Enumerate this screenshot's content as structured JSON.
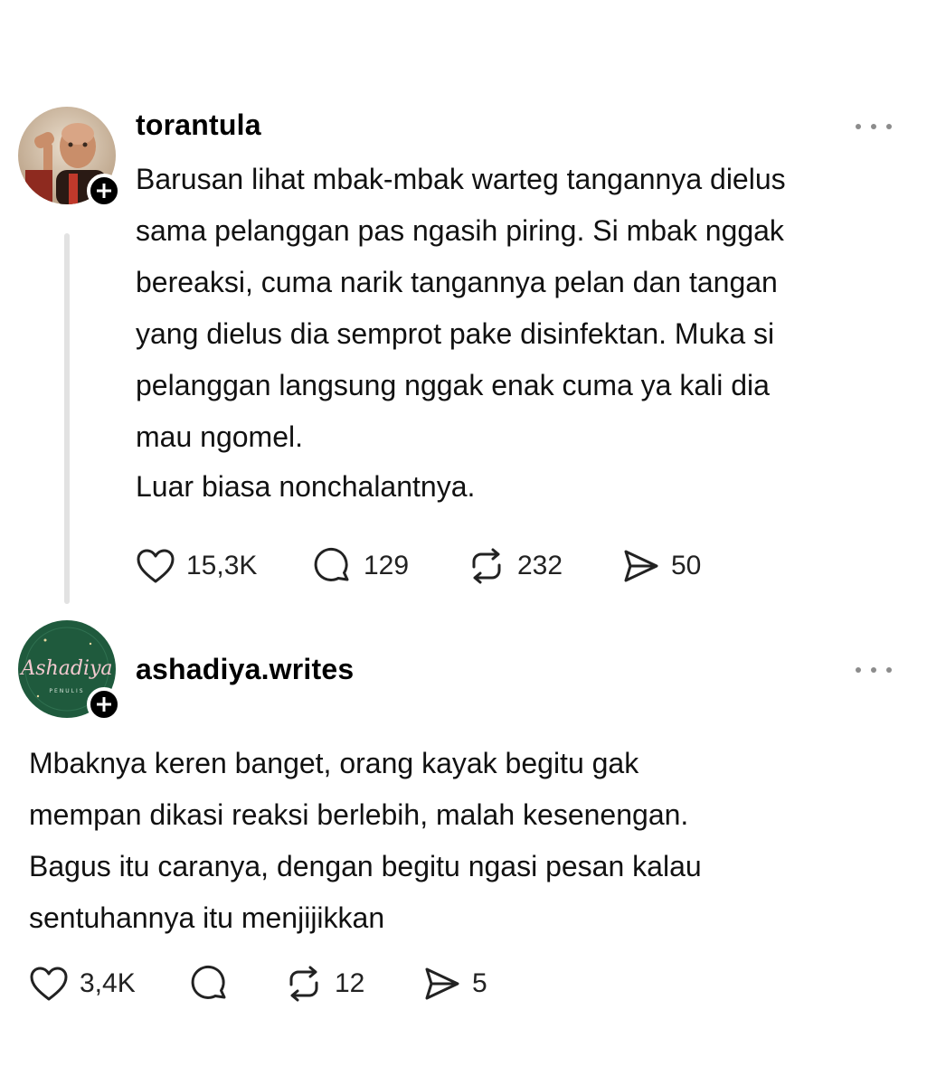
{
  "colors": {
    "background": "#ffffff",
    "text": "#111111",
    "muted": "#8c8c8c",
    "thread_line": "#e2e2e2",
    "badge": "#000000"
  },
  "posts": [
    {
      "username": "torantula",
      "avatar_icon": "user-photo-avatar",
      "more_icon": "more-dots-icon",
      "text_lines": [
        "Barusan lihat mbak-mbak warteg tangannya dielus",
        "sama pelanggan pas ngasih piring. Si mbak nggak",
        "bereaksi, cuma narik tangannya pelan dan tangan",
        "yang dielus dia semprot pake disinfektan. Muka si",
        "pelanggan langsung nggak enak cuma ya kali dia",
        "mau ngomel."
      ],
      "text_lines_2": [
        "Luar biasa nonchalantnya."
      ],
      "likes": "15,3K",
      "replies": "129",
      "reposts": "232",
      "shares": "50"
    },
    {
      "username": "ashadiya.writes",
      "avatar_icon": "ashadiya-logo-avatar",
      "avatar_logo_text": "Ashadiya",
      "avatar_logo_sub": "PENULIS",
      "more_icon": "more-dots-icon",
      "text_lines": [
        "Mbaknya keren banget, orang kayak begitu gak",
        "mempan dikasi reaksi berlebih, malah kesenengan.",
        "Bagus itu caranya, dengan begitu ngasi pesan kalau",
        "sentuhannya itu menjijikkan"
      ],
      "likes": "3,4K",
      "replies": "",
      "reposts": "12",
      "shares": "5"
    }
  ]
}
